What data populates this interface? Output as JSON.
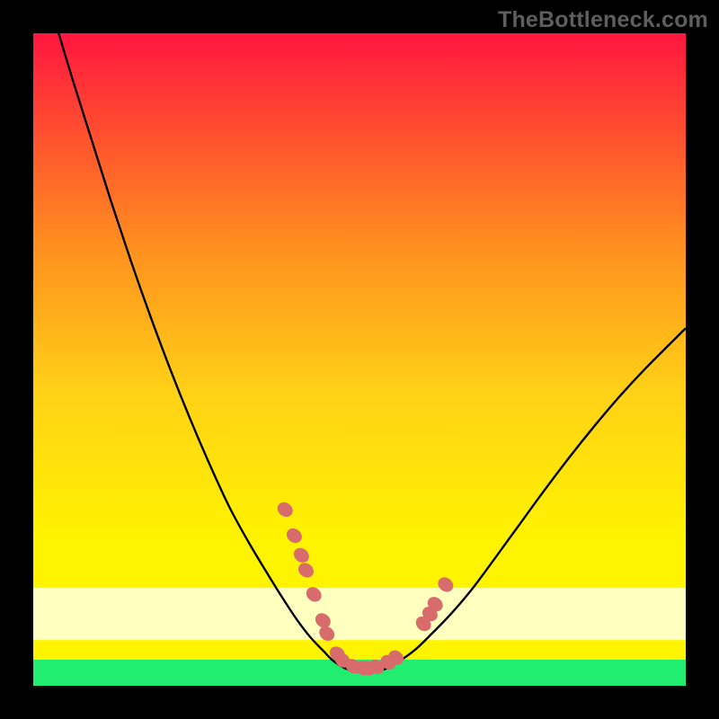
{
  "watermark": "TheBottleneck.com",
  "colors": {
    "frame": "#000000",
    "curve": "#000000",
    "marker_fill": "#d86b6b",
    "marker_stroke": "#b25050",
    "gradient_top": "#ff163f",
    "gradient_mid_upper": "#ff8d1f",
    "gradient_mid": "#ffd117",
    "gradient_mid_lower": "#fff400",
    "gradient_pale_band": "#ffffc0",
    "gradient_green": "#21ee70"
  },
  "chart_data": {
    "type": "line",
    "title": "",
    "xlabel": "",
    "ylabel": "",
    "xlim": [
      0,
      100
    ],
    "ylim": [
      0,
      100
    ],
    "series": [
      {
        "name": "bottleneck-curve",
        "x": [
          3,
          6,
          9,
          12,
          15,
          18,
          21,
          24,
          27,
          30,
          33,
          36,
          38.5,
          40.5,
          42.5,
          44.5,
          46,
          48,
          50,
          52,
          54,
          56,
          58.5,
          61,
          64,
          67,
          70,
          74,
          78,
          82,
          86,
          90,
          94,
          100
        ],
        "values": [
          103,
          93,
          83.5,
          74,
          65,
          56.5,
          48.5,
          41,
          34,
          27.5,
          22,
          17,
          13,
          10,
          7.4,
          5.3,
          3.8,
          2.6,
          2.1,
          2.1,
          2.6,
          3.7,
          5.5,
          7.9,
          11,
          14.5,
          18.5,
          24,
          29.5,
          34.8,
          39.8,
          44.5,
          48.8,
          54.8
        ]
      }
    ],
    "markers": {
      "name": "highlighted-points",
      "points": [
        {
          "x": 38.6,
          "y": 27.0
        },
        {
          "x": 40.0,
          "y": 23.0
        },
        {
          "x": 41.1,
          "y": 20.0
        },
        {
          "x": 41.8,
          "y": 17.7
        },
        {
          "x": 43.0,
          "y": 14.0
        },
        {
          "x": 44.4,
          "y": 10.0
        },
        {
          "x": 45.0,
          "y": 8.0
        },
        {
          "x": 46.6,
          "y": 4.9
        },
        {
          "x": 47.4,
          "y": 3.9
        },
        {
          "x": 49.0,
          "y": 3.0
        },
        {
          "x": 50.5,
          "y": 2.7
        },
        {
          "x": 51.3,
          "y": 2.7
        },
        {
          "x": 52.6,
          "y": 2.9
        },
        {
          "x": 54.4,
          "y": 3.6
        },
        {
          "x": 55.6,
          "y": 4.3
        },
        {
          "x": 59.8,
          "y": 9.5
        },
        {
          "x": 60.8,
          "y": 11.0
        },
        {
          "x": 61.6,
          "y": 12.5
        },
        {
          "x": 63.2,
          "y": 15.5
        }
      ]
    },
    "bands": [
      {
        "name": "pale-yellow-band",
        "y0": 7,
        "y1": 15,
        "color": "#ffffc0"
      },
      {
        "name": "green-band",
        "y0": 0,
        "y1": 4,
        "color": "#21ee70"
      }
    ]
  }
}
